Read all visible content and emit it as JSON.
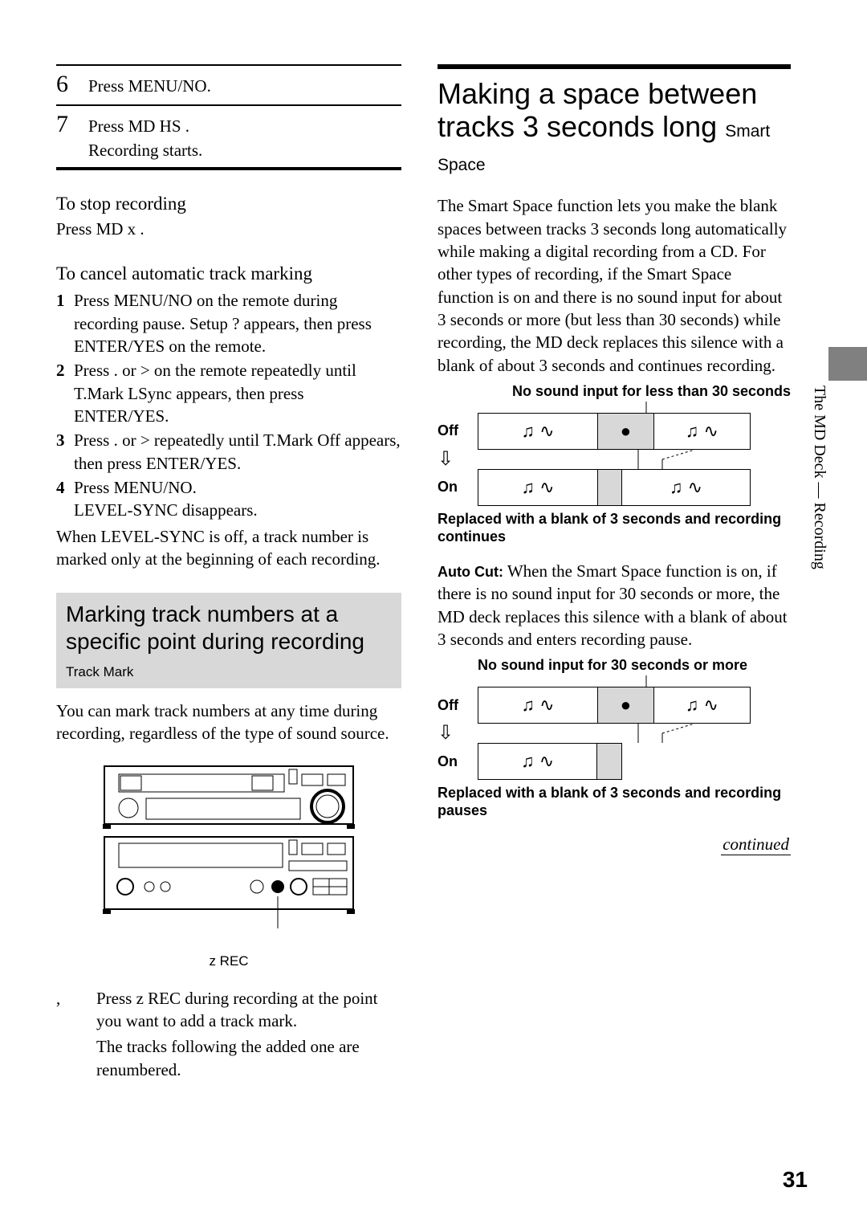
{
  "left": {
    "step6_num": "6",
    "step6_text": "Press MENU/NO.",
    "step7_num": "7",
    "step7_text": "Press MD HS .",
    "step7_sub": "Recording starts.",
    "stop_head": "To stop recording",
    "stop_body": "Press MD x .",
    "cancel_head": "To cancel automatic track marking",
    "cancel_items": [
      "Press MENU/NO on the remote during recording pause.  Setup ?  appears, then press ENTER/YES on the remote.",
      "Press .        or >        on the remote repeatedly until  T.Mark LSync  appears, then press ENTER/YES.",
      "Press .        or >        repeatedly until  T.Mark Off  appears, then press ENTER/YES.",
      "Press MENU/NO.\n LEVEL-SYNC  disappears."
    ],
    "cancel_tail": "When  LEVEL-SYNC  is off, a track number is marked only at the beginning of each recording.",
    "graybox_title": "Marking track numbers at a specific point during recording",
    "graybox_sub": "Track Mark",
    "graybox_para": "You can mark track numbers at any time during recording, regardless of the type of sound source.",
    "rec_label": "z  REC",
    "arrow_marker": ",",
    "arrow_text": "Press z  REC during recording at the point you want to add a track mark.",
    "arrow_sub": "The tracks following the added one are renumbered."
  },
  "right": {
    "title": "Making a space between tracks 3 seconds long",
    "title_sub": "Smart Space",
    "intro": "The Smart Space function lets you make the blank spaces between tracks 3 seconds long automatically while making a digital recording from a CD. For other types of recording, if the Smart Space function is on and there is no sound input for about 3 seconds or more (but less than 30 seconds) while recording, the MD deck replaces this silence with a blank of about 3 seconds and continues recording.",
    "d1_top": "No sound input for less than 30 seconds",
    "off": "Off",
    "on": "On",
    "d1_bottom": "Replaced with a blank of 3 seconds and recording continues",
    "para2_lead": "Auto Cut:",
    "para2": " When the Smart Space function is on, if there is no sound input for 30 seconds or more, the MD deck replaces this silence with a blank of about 3 seconds and enters recording pause.",
    "d2_top": "No sound input for 30 seconds or more",
    "d2_bottom": "Replaced with a blank of 3 seconds and recording pauses",
    "continued": "continued"
  },
  "sidebar": "The MD Deck — Recording",
  "page": "31",
  "glyphs": {
    "note": "♫ ∿",
    "dot": "●"
  }
}
